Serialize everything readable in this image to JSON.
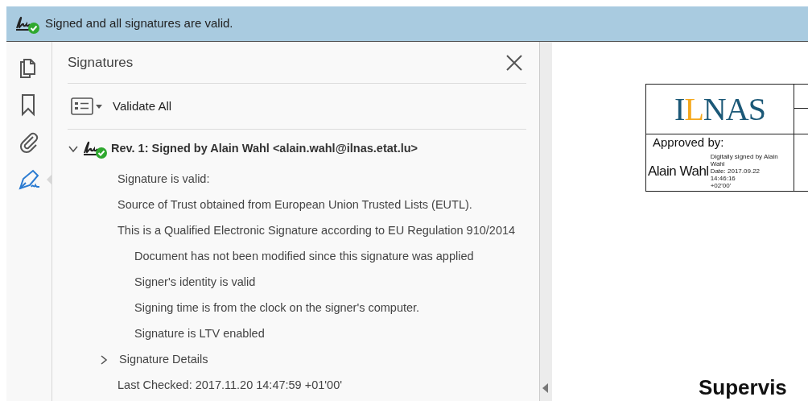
{
  "banner": {
    "text": "Signed and all signatures are valid."
  },
  "rail": [
    {
      "kind": "pages",
      "selected": false
    },
    {
      "kind": "bookmarks",
      "selected": false
    },
    {
      "kind": "attachments",
      "selected": false
    },
    {
      "kind": "signatures",
      "selected": true
    }
  ],
  "panel": {
    "title": "Signatures",
    "toolbar": {
      "label": "Validate All"
    },
    "signatures": [
      {
        "title": "Rev. 1: Signed by Alain Wahl <alain.wahl@ilnas.etat.lu>",
        "expanded": true,
        "valid": true,
        "lines": [
          {
            "text": "Signature is valid:"
          },
          {
            "text": "Source of Trust obtained from European Union Trusted Lists (EUTL)."
          },
          {
            "text": "This is a Qualified Electronic Signature according to EU Regulation 910/2014",
            "children": [
              {
                "text": "Document has not been modified since this signature was applied"
              },
              {
                "text": "Signer's identity is valid"
              },
              {
                "text": "Signing time is from the clock on the signer's computer."
              },
              {
                "text": "Signature is LTV enabled"
              }
            ]
          }
        ],
        "details": {
          "label": "Signature Details",
          "expanded": false
        },
        "last_checked": "Last Checked: 2017.11.20 14:47:59 +01'00'"
      }
    ]
  },
  "document": {
    "logo": [
      {
        "text": "I",
        "color": "#1b5877"
      },
      {
        "text": "L",
        "color": "#f5a81c"
      },
      {
        "text": "NAS",
        "color": "#1b5877"
      }
    ],
    "approved_label": "Approved by:",
    "signer_name": "Alain Wahl",
    "stamp": [
      "Digitally signed by Alain Wahl",
      "Date: 2017.09.22 14:46:16",
      "+02'00'"
    ],
    "heading": "Supervis"
  }
}
